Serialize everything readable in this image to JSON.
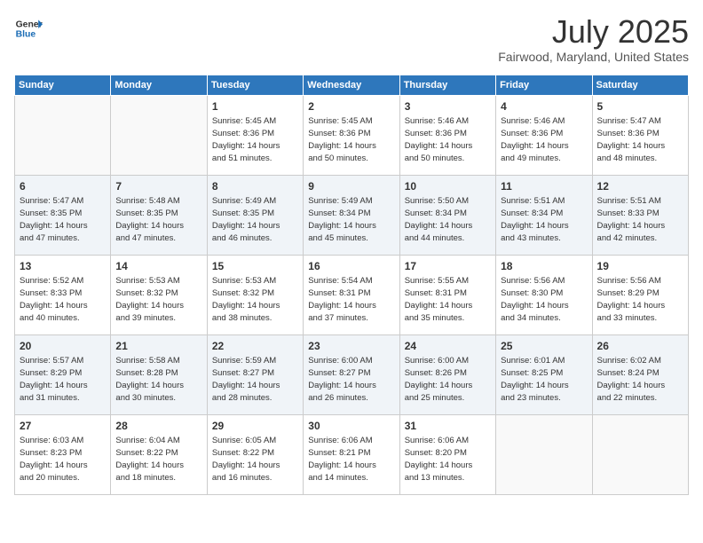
{
  "header": {
    "logo_general": "General",
    "logo_blue": "Blue",
    "month": "July 2025",
    "location": "Fairwood, Maryland, United States"
  },
  "weekdays": [
    "Sunday",
    "Monday",
    "Tuesday",
    "Wednesday",
    "Thursday",
    "Friday",
    "Saturday"
  ],
  "weeks": [
    [
      {
        "day": "",
        "info": ""
      },
      {
        "day": "",
        "info": ""
      },
      {
        "day": "1",
        "info": "Sunrise: 5:45 AM\nSunset: 8:36 PM\nDaylight: 14 hours\nand 51 minutes."
      },
      {
        "day": "2",
        "info": "Sunrise: 5:45 AM\nSunset: 8:36 PM\nDaylight: 14 hours\nand 50 minutes."
      },
      {
        "day": "3",
        "info": "Sunrise: 5:46 AM\nSunset: 8:36 PM\nDaylight: 14 hours\nand 50 minutes."
      },
      {
        "day": "4",
        "info": "Sunrise: 5:46 AM\nSunset: 8:36 PM\nDaylight: 14 hours\nand 49 minutes."
      },
      {
        "day": "5",
        "info": "Sunrise: 5:47 AM\nSunset: 8:36 PM\nDaylight: 14 hours\nand 48 minutes."
      }
    ],
    [
      {
        "day": "6",
        "info": "Sunrise: 5:47 AM\nSunset: 8:35 PM\nDaylight: 14 hours\nand 47 minutes."
      },
      {
        "day": "7",
        "info": "Sunrise: 5:48 AM\nSunset: 8:35 PM\nDaylight: 14 hours\nand 47 minutes."
      },
      {
        "day": "8",
        "info": "Sunrise: 5:49 AM\nSunset: 8:35 PM\nDaylight: 14 hours\nand 46 minutes."
      },
      {
        "day": "9",
        "info": "Sunrise: 5:49 AM\nSunset: 8:34 PM\nDaylight: 14 hours\nand 45 minutes."
      },
      {
        "day": "10",
        "info": "Sunrise: 5:50 AM\nSunset: 8:34 PM\nDaylight: 14 hours\nand 44 minutes."
      },
      {
        "day": "11",
        "info": "Sunrise: 5:51 AM\nSunset: 8:34 PM\nDaylight: 14 hours\nand 43 minutes."
      },
      {
        "day": "12",
        "info": "Sunrise: 5:51 AM\nSunset: 8:33 PM\nDaylight: 14 hours\nand 42 minutes."
      }
    ],
    [
      {
        "day": "13",
        "info": "Sunrise: 5:52 AM\nSunset: 8:33 PM\nDaylight: 14 hours\nand 40 minutes."
      },
      {
        "day": "14",
        "info": "Sunrise: 5:53 AM\nSunset: 8:32 PM\nDaylight: 14 hours\nand 39 minutes."
      },
      {
        "day": "15",
        "info": "Sunrise: 5:53 AM\nSunset: 8:32 PM\nDaylight: 14 hours\nand 38 minutes."
      },
      {
        "day": "16",
        "info": "Sunrise: 5:54 AM\nSunset: 8:31 PM\nDaylight: 14 hours\nand 37 minutes."
      },
      {
        "day": "17",
        "info": "Sunrise: 5:55 AM\nSunset: 8:31 PM\nDaylight: 14 hours\nand 35 minutes."
      },
      {
        "day": "18",
        "info": "Sunrise: 5:56 AM\nSunset: 8:30 PM\nDaylight: 14 hours\nand 34 minutes."
      },
      {
        "day": "19",
        "info": "Sunrise: 5:56 AM\nSunset: 8:29 PM\nDaylight: 14 hours\nand 33 minutes."
      }
    ],
    [
      {
        "day": "20",
        "info": "Sunrise: 5:57 AM\nSunset: 8:29 PM\nDaylight: 14 hours\nand 31 minutes."
      },
      {
        "day": "21",
        "info": "Sunrise: 5:58 AM\nSunset: 8:28 PM\nDaylight: 14 hours\nand 30 minutes."
      },
      {
        "day": "22",
        "info": "Sunrise: 5:59 AM\nSunset: 8:27 PM\nDaylight: 14 hours\nand 28 minutes."
      },
      {
        "day": "23",
        "info": "Sunrise: 6:00 AM\nSunset: 8:27 PM\nDaylight: 14 hours\nand 26 minutes."
      },
      {
        "day": "24",
        "info": "Sunrise: 6:00 AM\nSunset: 8:26 PM\nDaylight: 14 hours\nand 25 minutes."
      },
      {
        "day": "25",
        "info": "Sunrise: 6:01 AM\nSunset: 8:25 PM\nDaylight: 14 hours\nand 23 minutes."
      },
      {
        "day": "26",
        "info": "Sunrise: 6:02 AM\nSunset: 8:24 PM\nDaylight: 14 hours\nand 22 minutes."
      }
    ],
    [
      {
        "day": "27",
        "info": "Sunrise: 6:03 AM\nSunset: 8:23 PM\nDaylight: 14 hours\nand 20 minutes."
      },
      {
        "day": "28",
        "info": "Sunrise: 6:04 AM\nSunset: 8:22 PM\nDaylight: 14 hours\nand 18 minutes."
      },
      {
        "day": "29",
        "info": "Sunrise: 6:05 AM\nSunset: 8:22 PM\nDaylight: 14 hours\nand 16 minutes."
      },
      {
        "day": "30",
        "info": "Sunrise: 6:06 AM\nSunset: 8:21 PM\nDaylight: 14 hours\nand 14 minutes."
      },
      {
        "day": "31",
        "info": "Sunrise: 6:06 AM\nSunset: 8:20 PM\nDaylight: 14 hours\nand 13 minutes."
      },
      {
        "day": "",
        "info": ""
      },
      {
        "day": "",
        "info": ""
      }
    ]
  ]
}
